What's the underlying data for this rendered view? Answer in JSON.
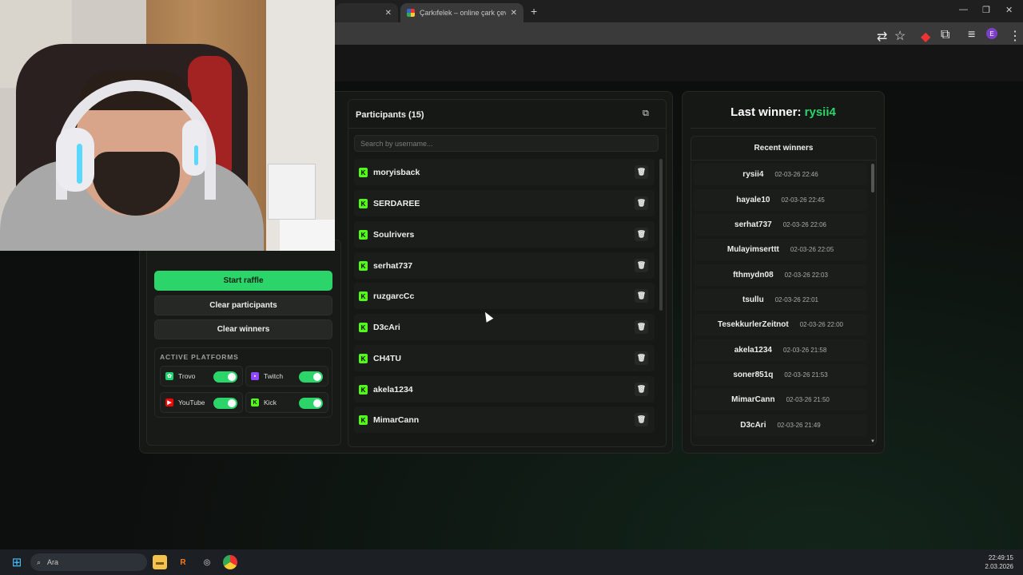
{
  "browser": {
    "tabs": [
      {
        "title": ""
      },
      {
        "title": "Çarkıfelek – online çark çevirme"
      }
    ],
    "new_tab_symbol": "+",
    "window_controls": [
      "—",
      "❐",
      "✕"
    ]
  },
  "controls": {
    "start_label": "Start raffle",
    "clear_participants_label": "Clear participants",
    "clear_winners_label": "Clear winners",
    "platforms_title": "ACTIVE PLATFORMS",
    "platforms": [
      {
        "name": "Trovo",
        "enabled": true,
        "color": "#19d66b"
      },
      {
        "name": "Twitch",
        "enabled": true,
        "color": "#9146ff"
      },
      {
        "name": "YouTube",
        "enabled": true,
        "color": "#ff0000"
      },
      {
        "name": "Kick",
        "enabled": true,
        "color": "#53fc18"
      }
    ]
  },
  "participants": {
    "title": "Participants (15)",
    "search_placeholder": "Search by username...",
    "items": [
      {
        "name": "moryisback"
      },
      {
        "name": "SERDAREE"
      },
      {
        "name": "Soulrivers"
      },
      {
        "name": "serhat737"
      },
      {
        "name": "ruzgarcCc"
      },
      {
        "name": "D3cAri"
      },
      {
        "name": "CH4TU"
      },
      {
        "name": "akela1234"
      },
      {
        "name": "MimarCann"
      }
    ]
  },
  "winners": {
    "last_prefix": "Last winner: ",
    "last_name": "rysii4",
    "recent_title": "Recent winners",
    "items": [
      {
        "name": "rysii4",
        "date": "02-03-26 22:46"
      },
      {
        "name": "hayale10",
        "date": "02-03-26 22:45"
      },
      {
        "name": "serhat737",
        "date": "02-03-26 22:06"
      },
      {
        "name": "Mulayimserttt",
        "date": "02-03-26 22:05"
      },
      {
        "name": "fthmydn08",
        "date": "02-03-26 22:03"
      },
      {
        "name": "tsullu",
        "date": "02-03-26 22:01"
      },
      {
        "name": "TesekkurlerZeitnot",
        "date": "02-03-26 22:00"
      },
      {
        "name": "akela1234",
        "date": "02-03-26 21:58"
      },
      {
        "name": "soner851q",
        "date": "02-03-26 21:53"
      },
      {
        "name": "MimarCann",
        "date": "02-03-26 21:50"
      },
      {
        "name": "D3cAri",
        "date": "02-03-26 21:49"
      }
    ]
  },
  "taskbar": {
    "search_placeholder": "Ara",
    "time": "22:49:15",
    "date": "2.03.2026"
  },
  "colors": {
    "accent": "#2bd56a",
    "kick": "#53fc18",
    "panel": "#161816"
  }
}
